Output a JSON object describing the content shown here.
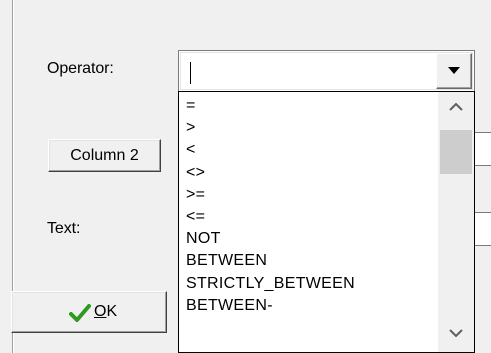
{
  "dialog": {
    "operator_label": "Operator:",
    "text_label": "Text:",
    "column_button_label": "Column 2",
    "ok_label": "OK",
    "ok_mnemonic_letter": "O",
    "ok_rest": "K"
  },
  "operator_combo": {
    "value": "",
    "options": [
      "=",
      ">",
      "<",
      "<>",
      ">=",
      "<=",
      "NOT",
      "BETWEEN",
      "STRICTLY_BETWEEN",
      "BETWEEN-"
    ]
  },
  "icons": {
    "ok": "check-icon",
    "dropdown": "triangle-down-icon",
    "scroll_up": "chevron-up-icon",
    "scroll_down": "chevron-down-icon"
  },
  "colors": {
    "face": "#f0f0f0",
    "check_green": "#2e9a1f",
    "scroll_thumb": "#cdcdcd"
  }
}
